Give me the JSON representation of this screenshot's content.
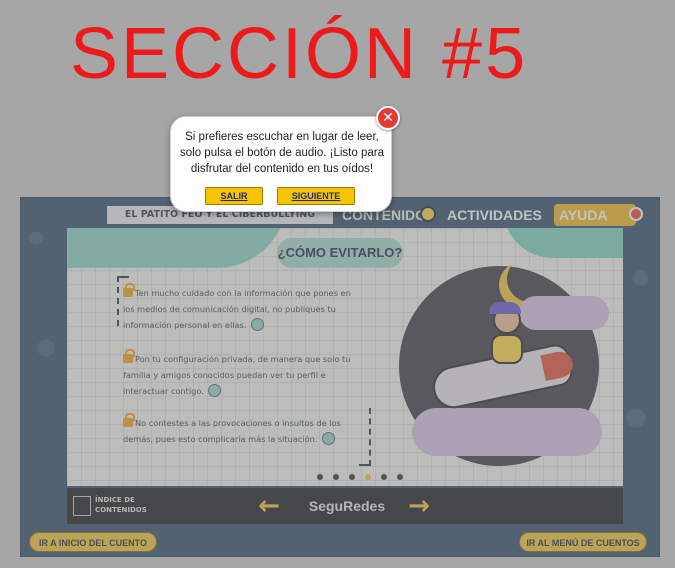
{
  "section_title": "SECCIÓN #5",
  "nav": {
    "book_title": "EL PATITO FEO Y EL CIBERBULLYING",
    "contents": "CONTENIDOS",
    "activities": "ACTIVIDADES",
    "help": "AYUDA"
  },
  "page": {
    "heading": "¿CÓMO EVITARLO?",
    "tips": [
      "Ten mucho cuidado con la información que pones en los medios de comunicación digital, no publiques tu información personal en ellas.",
      "Pon tu configuración privada, de manera que solo tu familia y amigos conocidos puedan ver tu perfil e interactuar contigo.",
      "No contestes a las provocaciones o insultos de los demás, pues esto complicaría más la situación."
    ]
  },
  "bottom": {
    "index_label": "ÍNDICE DE CONTENIDOS",
    "brand": "SeguRedes",
    "prev_arrow": "←",
    "next_arrow": "→"
  },
  "footer": {
    "left": "IR A INICIO DEL CUENTO",
    "right": "IR AL MENÚ DE CUENTOS"
  },
  "popup": {
    "message": "Si prefieres escuchar en lugar de leer, solo pulsa el botón de audio. ¡Listo para disfrutar del contenido en tus oídos!",
    "exit_label": "SALIR",
    "next_label": "SIGUIENTE",
    "close_glyph": "✕"
  },
  "colors": {
    "title_red": "#ee1a1a",
    "accent_yellow": "#f4c400",
    "frame_blue": "#36506e",
    "teal": "#7fd3c2"
  }
}
